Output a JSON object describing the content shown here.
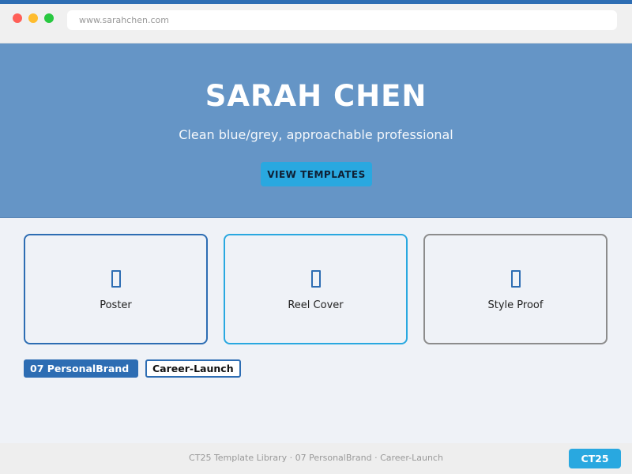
{
  "browser": {
    "url": "www.sarahchen.com"
  },
  "hero": {
    "title": "SARAH CHEN",
    "subtitle": "Clean blue/grey, approachable professional",
    "cta_label": "VIEW TEMPLATES"
  },
  "cards": [
    {
      "label": "Poster",
      "icon": "document-icon"
    },
    {
      "label": "Reel Cover",
      "icon": "document-icon"
    },
    {
      "label": "Style Proof",
      "icon": "document-icon"
    }
  ],
  "tags": [
    {
      "label": "07 PersonalBrand"
    },
    {
      "label": "Career-Launch"
    }
  ],
  "footer": {
    "text": "CT25 Template Library · 07 PersonalBrand · Career-Launch",
    "badge": "CT25"
  },
  "colors": {
    "accent_dark": "#2d6db3",
    "accent_light": "#29a8e0",
    "hero_bg": "#6595c6",
    "neutral_border": "#8c8c8c"
  }
}
